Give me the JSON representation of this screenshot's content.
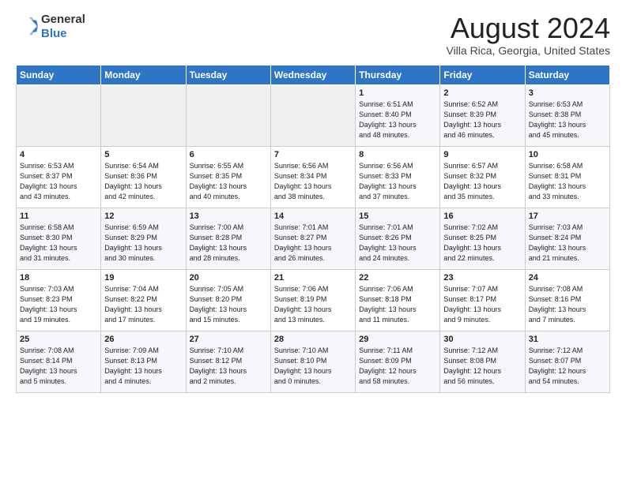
{
  "header": {
    "logo_general": "General",
    "logo_blue": "Blue",
    "month_year": "August 2024",
    "location": "Villa Rica, Georgia, United States"
  },
  "weekdays": [
    "Sunday",
    "Monday",
    "Tuesday",
    "Wednesday",
    "Thursday",
    "Friday",
    "Saturday"
  ],
  "weeks": [
    [
      {
        "day": "",
        "info": ""
      },
      {
        "day": "",
        "info": ""
      },
      {
        "day": "",
        "info": ""
      },
      {
        "day": "",
        "info": ""
      },
      {
        "day": "1",
        "info": "Sunrise: 6:51 AM\nSunset: 8:40 PM\nDaylight: 13 hours\nand 48 minutes."
      },
      {
        "day": "2",
        "info": "Sunrise: 6:52 AM\nSunset: 8:39 PM\nDaylight: 13 hours\nand 46 minutes."
      },
      {
        "day": "3",
        "info": "Sunrise: 6:53 AM\nSunset: 8:38 PM\nDaylight: 13 hours\nand 45 minutes."
      }
    ],
    [
      {
        "day": "4",
        "info": "Sunrise: 6:53 AM\nSunset: 8:37 PM\nDaylight: 13 hours\nand 43 minutes."
      },
      {
        "day": "5",
        "info": "Sunrise: 6:54 AM\nSunset: 8:36 PM\nDaylight: 13 hours\nand 42 minutes."
      },
      {
        "day": "6",
        "info": "Sunrise: 6:55 AM\nSunset: 8:35 PM\nDaylight: 13 hours\nand 40 minutes."
      },
      {
        "day": "7",
        "info": "Sunrise: 6:56 AM\nSunset: 8:34 PM\nDaylight: 13 hours\nand 38 minutes."
      },
      {
        "day": "8",
        "info": "Sunrise: 6:56 AM\nSunset: 8:33 PM\nDaylight: 13 hours\nand 37 minutes."
      },
      {
        "day": "9",
        "info": "Sunrise: 6:57 AM\nSunset: 8:32 PM\nDaylight: 13 hours\nand 35 minutes."
      },
      {
        "day": "10",
        "info": "Sunrise: 6:58 AM\nSunset: 8:31 PM\nDaylight: 13 hours\nand 33 minutes."
      }
    ],
    [
      {
        "day": "11",
        "info": "Sunrise: 6:58 AM\nSunset: 8:30 PM\nDaylight: 13 hours\nand 31 minutes."
      },
      {
        "day": "12",
        "info": "Sunrise: 6:59 AM\nSunset: 8:29 PM\nDaylight: 13 hours\nand 30 minutes."
      },
      {
        "day": "13",
        "info": "Sunrise: 7:00 AM\nSunset: 8:28 PM\nDaylight: 13 hours\nand 28 minutes."
      },
      {
        "day": "14",
        "info": "Sunrise: 7:01 AM\nSunset: 8:27 PM\nDaylight: 13 hours\nand 26 minutes."
      },
      {
        "day": "15",
        "info": "Sunrise: 7:01 AM\nSunset: 8:26 PM\nDaylight: 13 hours\nand 24 minutes."
      },
      {
        "day": "16",
        "info": "Sunrise: 7:02 AM\nSunset: 8:25 PM\nDaylight: 13 hours\nand 22 minutes."
      },
      {
        "day": "17",
        "info": "Sunrise: 7:03 AM\nSunset: 8:24 PM\nDaylight: 13 hours\nand 21 minutes."
      }
    ],
    [
      {
        "day": "18",
        "info": "Sunrise: 7:03 AM\nSunset: 8:23 PM\nDaylight: 13 hours\nand 19 minutes."
      },
      {
        "day": "19",
        "info": "Sunrise: 7:04 AM\nSunset: 8:22 PM\nDaylight: 13 hours\nand 17 minutes."
      },
      {
        "day": "20",
        "info": "Sunrise: 7:05 AM\nSunset: 8:20 PM\nDaylight: 13 hours\nand 15 minutes."
      },
      {
        "day": "21",
        "info": "Sunrise: 7:06 AM\nSunset: 8:19 PM\nDaylight: 13 hours\nand 13 minutes."
      },
      {
        "day": "22",
        "info": "Sunrise: 7:06 AM\nSunset: 8:18 PM\nDaylight: 13 hours\nand 11 minutes."
      },
      {
        "day": "23",
        "info": "Sunrise: 7:07 AM\nSunset: 8:17 PM\nDaylight: 13 hours\nand 9 minutes."
      },
      {
        "day": "24",
        "info": "Sunrise: 7:08 AM\nSunset: 8:16 PM\nDaylight: 13 hours\nand 7 minutes."
      }
    ],
    [
      {
        "day": "25",
        "info": "Sunrise: 7:08 AM\nSunset: 8:14 PM\nDaylight: 13 hours\nand 5 minutes."
      },
      {
        "day": "26",
        "info": "Sunrise: 7:09 AM\nSunset: 8:13 PM\nDaylight: 13 hours\nand 4 minutes."
      },
      {
        "day": "27",
        "info": "Sunrise: 7:10 AM\nSunset: 8:12 PM\nDaylight: 13 hours\nand 2 minutes."
      },
      {
        "day": "28",
        "info": "Sunrise: 7:10 AM\nSunset: 8:10 PM\nDaylight: 13 hours\nand 0 minutes."
      },
      {
        "day": "29",
        "info": "Sunrise: 7:11 AM\nSunset: 8:09 PM\nDaylight: 12 hours\nand 58 minutes."
      },
      {
        "day": "30",
        "info": "Sunrise: 7:12 AM\nSunset: 8:08 PM\nDaylight: 12 hours\nand 56 minutes."
      },
      {
        "day": "31",
        "info": "Sunrise: 7:12 AM\nSunset: 8:07 PM\nDaylight: 12 hours\nand 54 minutes."
      }
    ]
  ]
}
